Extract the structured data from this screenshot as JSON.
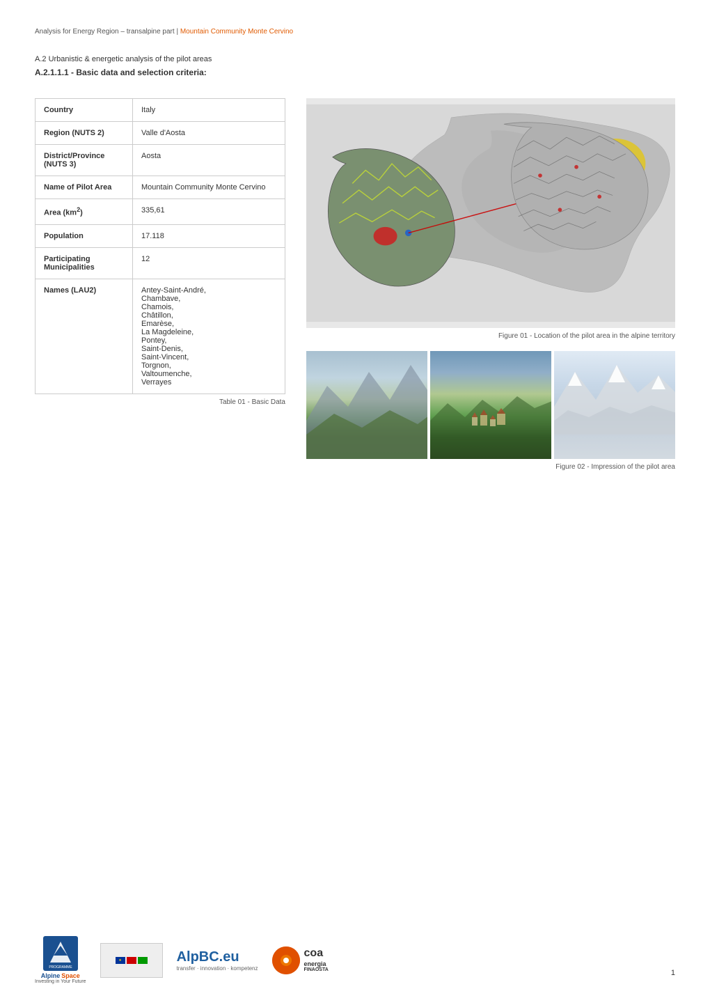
{
  "header": {
    "text": "Analysis for Energy Region – transalpine part | ",
    "link_text": "Mountain Community Monte Cervino"
  },
  "subtitle1": "A.2 Urbanistic & energetic analysis of the pilot areas",
  "subtitle2": "A.2.1.1.1 - Basic data and selection criteria:",
  "table": {
    "rows": [
      {
        "label": "Country",
        "value": "Italy"
      },
      {
        "label": "Region (NUTS 2)",
        "value": "Valle d'Aosta"
      },
      {
        "label": "District/Province (NUTS 3)",
        "value": "Aosta"
      },
      {
        "label": "Name of Pilot Area",
        "value": "Mountain Community Monte Cervino"
      },
      {
        "label": "Area (km²)",
        "value": "335,61"
      },
      {
        "label": "Population",
        "value": "17.118"
      },
      {
        "label": "Participating Municipalities",
        "value": "12"
      },
      {
        "label": "Names (LAU2)",
        "value": "Antey-Saint-André, Chambave, Chamois, Châtillon, Emarèse, La Magdeleine, Pontey, Saint-Denis, Saint-Vincent, Torgnon, Valtoumenche, Verrayes"
      }
    ],
    "caption": "Table 01 - Basic Data"
  },
  "figure1_caption": "Figure 01 - Location of the pilot area in the alpine territory",
  "figure2_caption": "Figure 02 - Impression of the pilot area",
  "footer": {
    "logo1_line1": "Alpine",
    "logo1_line2": "Space",
    "logo1_line3": "PROGRAMME",
    "logo2_text": "AlpBC.eu",
    "logo2_sub": "transfer · innovation · kompetenz",
    "logo3_circle": "●",
    "logo3_main": "coa",
    "logo3_sub": "energia",
    "logo3_brand": "FINAOSTA"
  },
  "page_number": "1"
}
